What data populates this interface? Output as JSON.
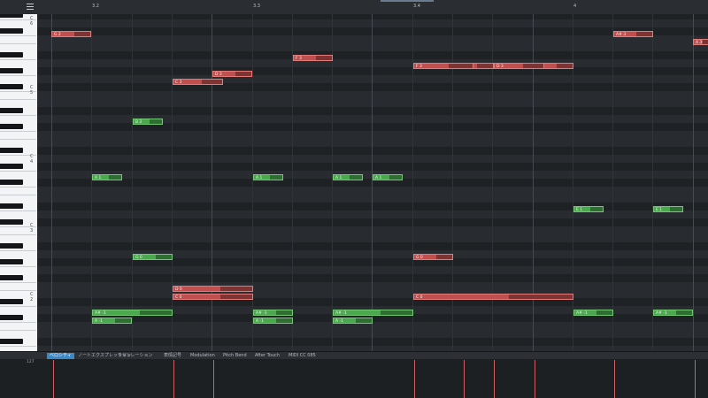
{
  "ruler": {
    "labels": [
      "3.2",
      "3.3",
      "3.4",
      "4"
    ]
  },
  "keyboard": {
    "octave_labels": [
      "C 6",
      "C 5",
      "C 4",
      "C 3",
      "C 2"
    ]
  },
  "notes": [
    {
      "label": "G 2",
      "color": "red"
    },
    {
      "label": "F 3",
      "color": "red"
    },
    {
      "label": "C 3",
      "color": "red"
    },
    {
      "label": "D 3",
      "color": "red"
    },
    {
      "label": "F 3",
      "color": "red"
    },
    {
      "label": "E 3",
      "color": "red"
    },
    {
      "label": "F 3",
      "color": "red"
    },
    {
      "label": "D 3",
      "color": "red"
    },
    {
      "label": "F 3",
      "color": "red"
    },
    {
      "label": "A# 3",
      "color": "red"
    },
    {
      "label": "A 3",
      "color": "red"
    },
    {
      "label": "B 2",
      "color": "green"
    },
    {
      "label": "A 1",
      "color": "green"
    },
    {
      "label": "A 1",
      "color": "green"
    },
    {
      "label": "A 1",
      "color": "green"
    },
    {
      "label": "A 1",
      "color": "green"
    },
    {
      "label": "E 1",
      "color": "green"
    },
    {
      "label": "E 1",
      "color": "green"
    },
    {
      "label": "G 0",
      "color": "green"
    },
    {
      "label": "G 0",
      "color": "red"
    },
    {
      "label": "D 0",
      "color": "red"
    },
    {
      "label": "C 0",
      "color": "red"
    },
    {
      "label": "C 0",
      "color": "red"
    },
    {
      "label": "A# -1",
      "color": "green"
    },
    {
      "label": "A -1",
      "color": "green"
    },
    {
      "label": "A# -1",
      "color": "green"
    },
    {
      "label": "A -1",
      "color": "green"
    },
    {
      "label": "A# -1",
      "color": "green"
    },
    {
      "label": "A -1",
      "color": "green"
    },
    {
      "label": "A# -1",
      "color": "green"
    },
    {
      "label": "A# -1",
      "color": "green"
    }
  ],
  "controller": {
    "tabs": [
      "ベロシティ",
      "ノートエクスプレッション",
      "モジュレーション",
      "表情記号",
      "Modulation",
      "Pitch Bend",
      "After Touch",
      "MIDI CC 085"
    ],
    "active_tab": "ベロシティ",
    "max_label": "127"
  }
}
